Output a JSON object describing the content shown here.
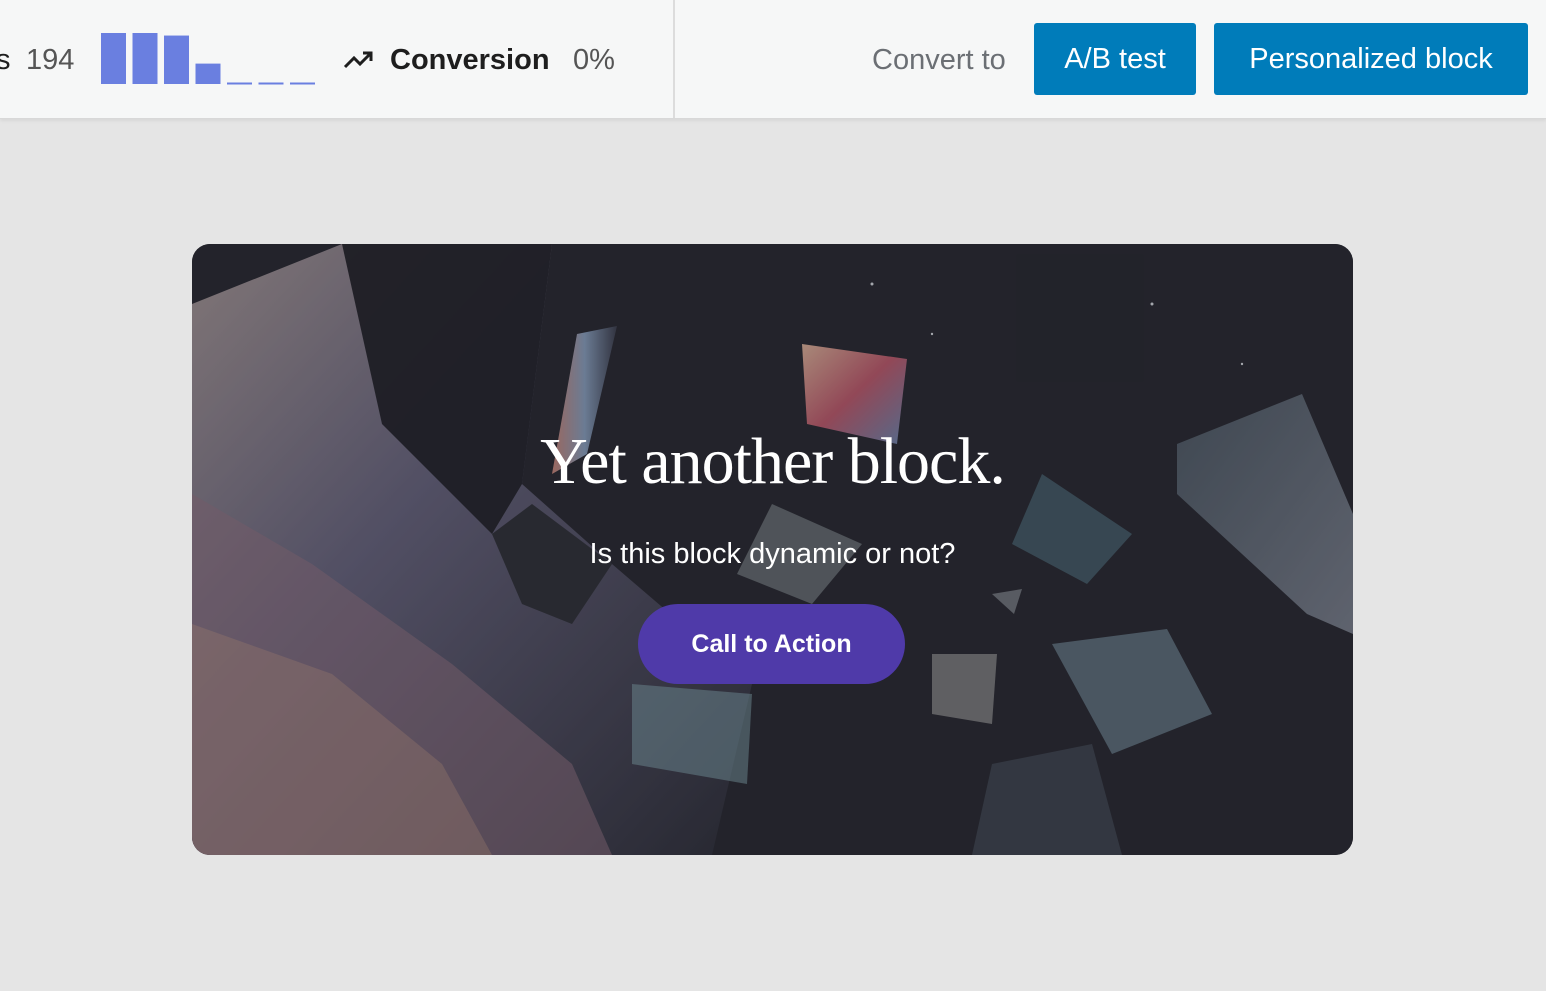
{
  "toolbar": {
    "stats_label": "s",
    "stats_value": "194",
    "sparkline": {
      "bar_color": "#6a7fe0",
      "values": [
        1.0,
        1.0,
        0.95,
        0.4,
        0,
        0,
        0
      ]
    },
    "trend_icon": "trending-up-icon",
    "conversion_label": "Conversion",
    "conversion_value": "0%",
    "convert_label": "Convert to",
    "ab_test_label": "A/B test",
    "personalized_label": "Personalized block",
    "accent_color": "#007cba"
  },
  "hero": {
    "title": "Yet another block.",
    "subtitle": "Is this block dynamic or not?",
    "cta_label": "Call to Action",
    "cta_color": "#4f3aa9"
  }
}
